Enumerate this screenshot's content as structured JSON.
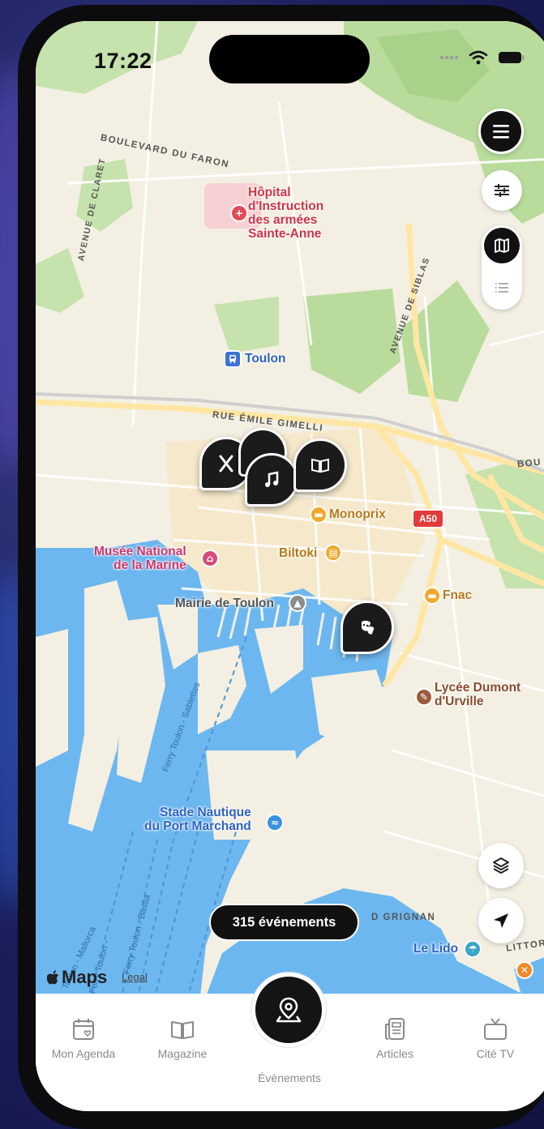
{
  "status_bar": {
    "time": "17:22"
  },
  "map": {
    "streets": {
      "boulevard_faron": "Boulevard du Faron",
      "avenue_claret": "Avenue de Claret",
      "avenue_siblas": "Avenue de Siblas",
      "rue_emile_gimelli": "Rue Émile Gimelli",
      "bou": "BOU",
      "grignan": "D GRIGNAN",
      "littoral": "LITTORAL"
    },
    "route_badge": "A50",
    "pois": {
      "hopital": "Hôpital\nd'Instruction\ndes armées\nSainte-Anne",
      "toulon": "Toulon",
      "monoprix": "Monoprix",
      "biltoki": "Biltoki",
      "musee": "Musée National\nde la Marine",
      "mairie": "Mairie de Toulon",
      "fnac": "Fnac",
      "lycee": "Lycée Dumont\nd'Urville",
      "stade": "Stade Nautique\ndu Port Marchand",
      "lido": "Le Lido",
      "ferry_sablettes": "Ferry Toulon - Sablettes",
      "ferry_bastia": "Ferry Toulon - Bastia",
      "ferry_mallorca": "Toulon - Mallorca",
      "ferry_ajaccio": "Ferry Toulon -",
      "ferry_pani": "pani"
    },
    "attribution": {
      "maps": "Maps",
      "legal": "Legal"
    }
  },
  "controls": {
    "menu_icon": "hamburger-icon",
    "filter_icon": "sliders-icon",
    "map_view_icon": "map-icon",
    "list_view_icon": "list-icon",
    "layers_icon": "layers-icon",
    "location_icon": "location-arrow-icon"
  },
  "events_count": "315 événements",
  "tabbar": {
    "tabs": [
      {
        "label": "Mon Agenda",
        "icon": "calendar-heart-icon"
      },
      {
        "label": "Magazine",
        "icon": "book-open-icon"
      },
      {
        "label": "Évènements",
        "icon": "map-pin-icon"
      },
      {
        "label": "Articles",
        "icon": "newspaper-icon"
      },
      {
        "label": "Cité TV",
        "icon": "tv-icon"
      }
    ]
  },
  "colors": {
    "water": "#6cb7f0",
    "land": "#f3efe2",
    "park": "#b9dc9c",
    "road_major": "#ffe7a3",
    "pin": "#1b1b1b",
    "hospital": "#e24b57",
    "poi_orange": "#f0a92c",
    "route_badge": "#e23b3b"
  }
}
